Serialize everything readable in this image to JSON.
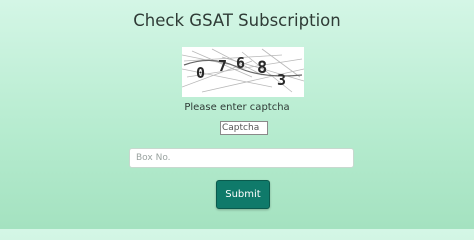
{
  "page": {
    "title": "Check GSAT Subscription"
  },
  "captcha": {
    "digits": [
      "0",
      "7",
      "6",
      "8",
      "3"
    ],
    "prompt": "Please enter captcha",
    "input_placeholder": "Captcha",
    "input_value": ""
  },
  "box_field": {
    "placeholder": "Box No.",
    "value": ""
  },
  "submit": {
    "label": "Submit"
  },
  "colors": {
    "background_top": "#d4f6e6",
    "background_bottom": "#a4e2c0",
    "button": "#0f7a6a",
    "button_text": "#ffffff"
  }
}
